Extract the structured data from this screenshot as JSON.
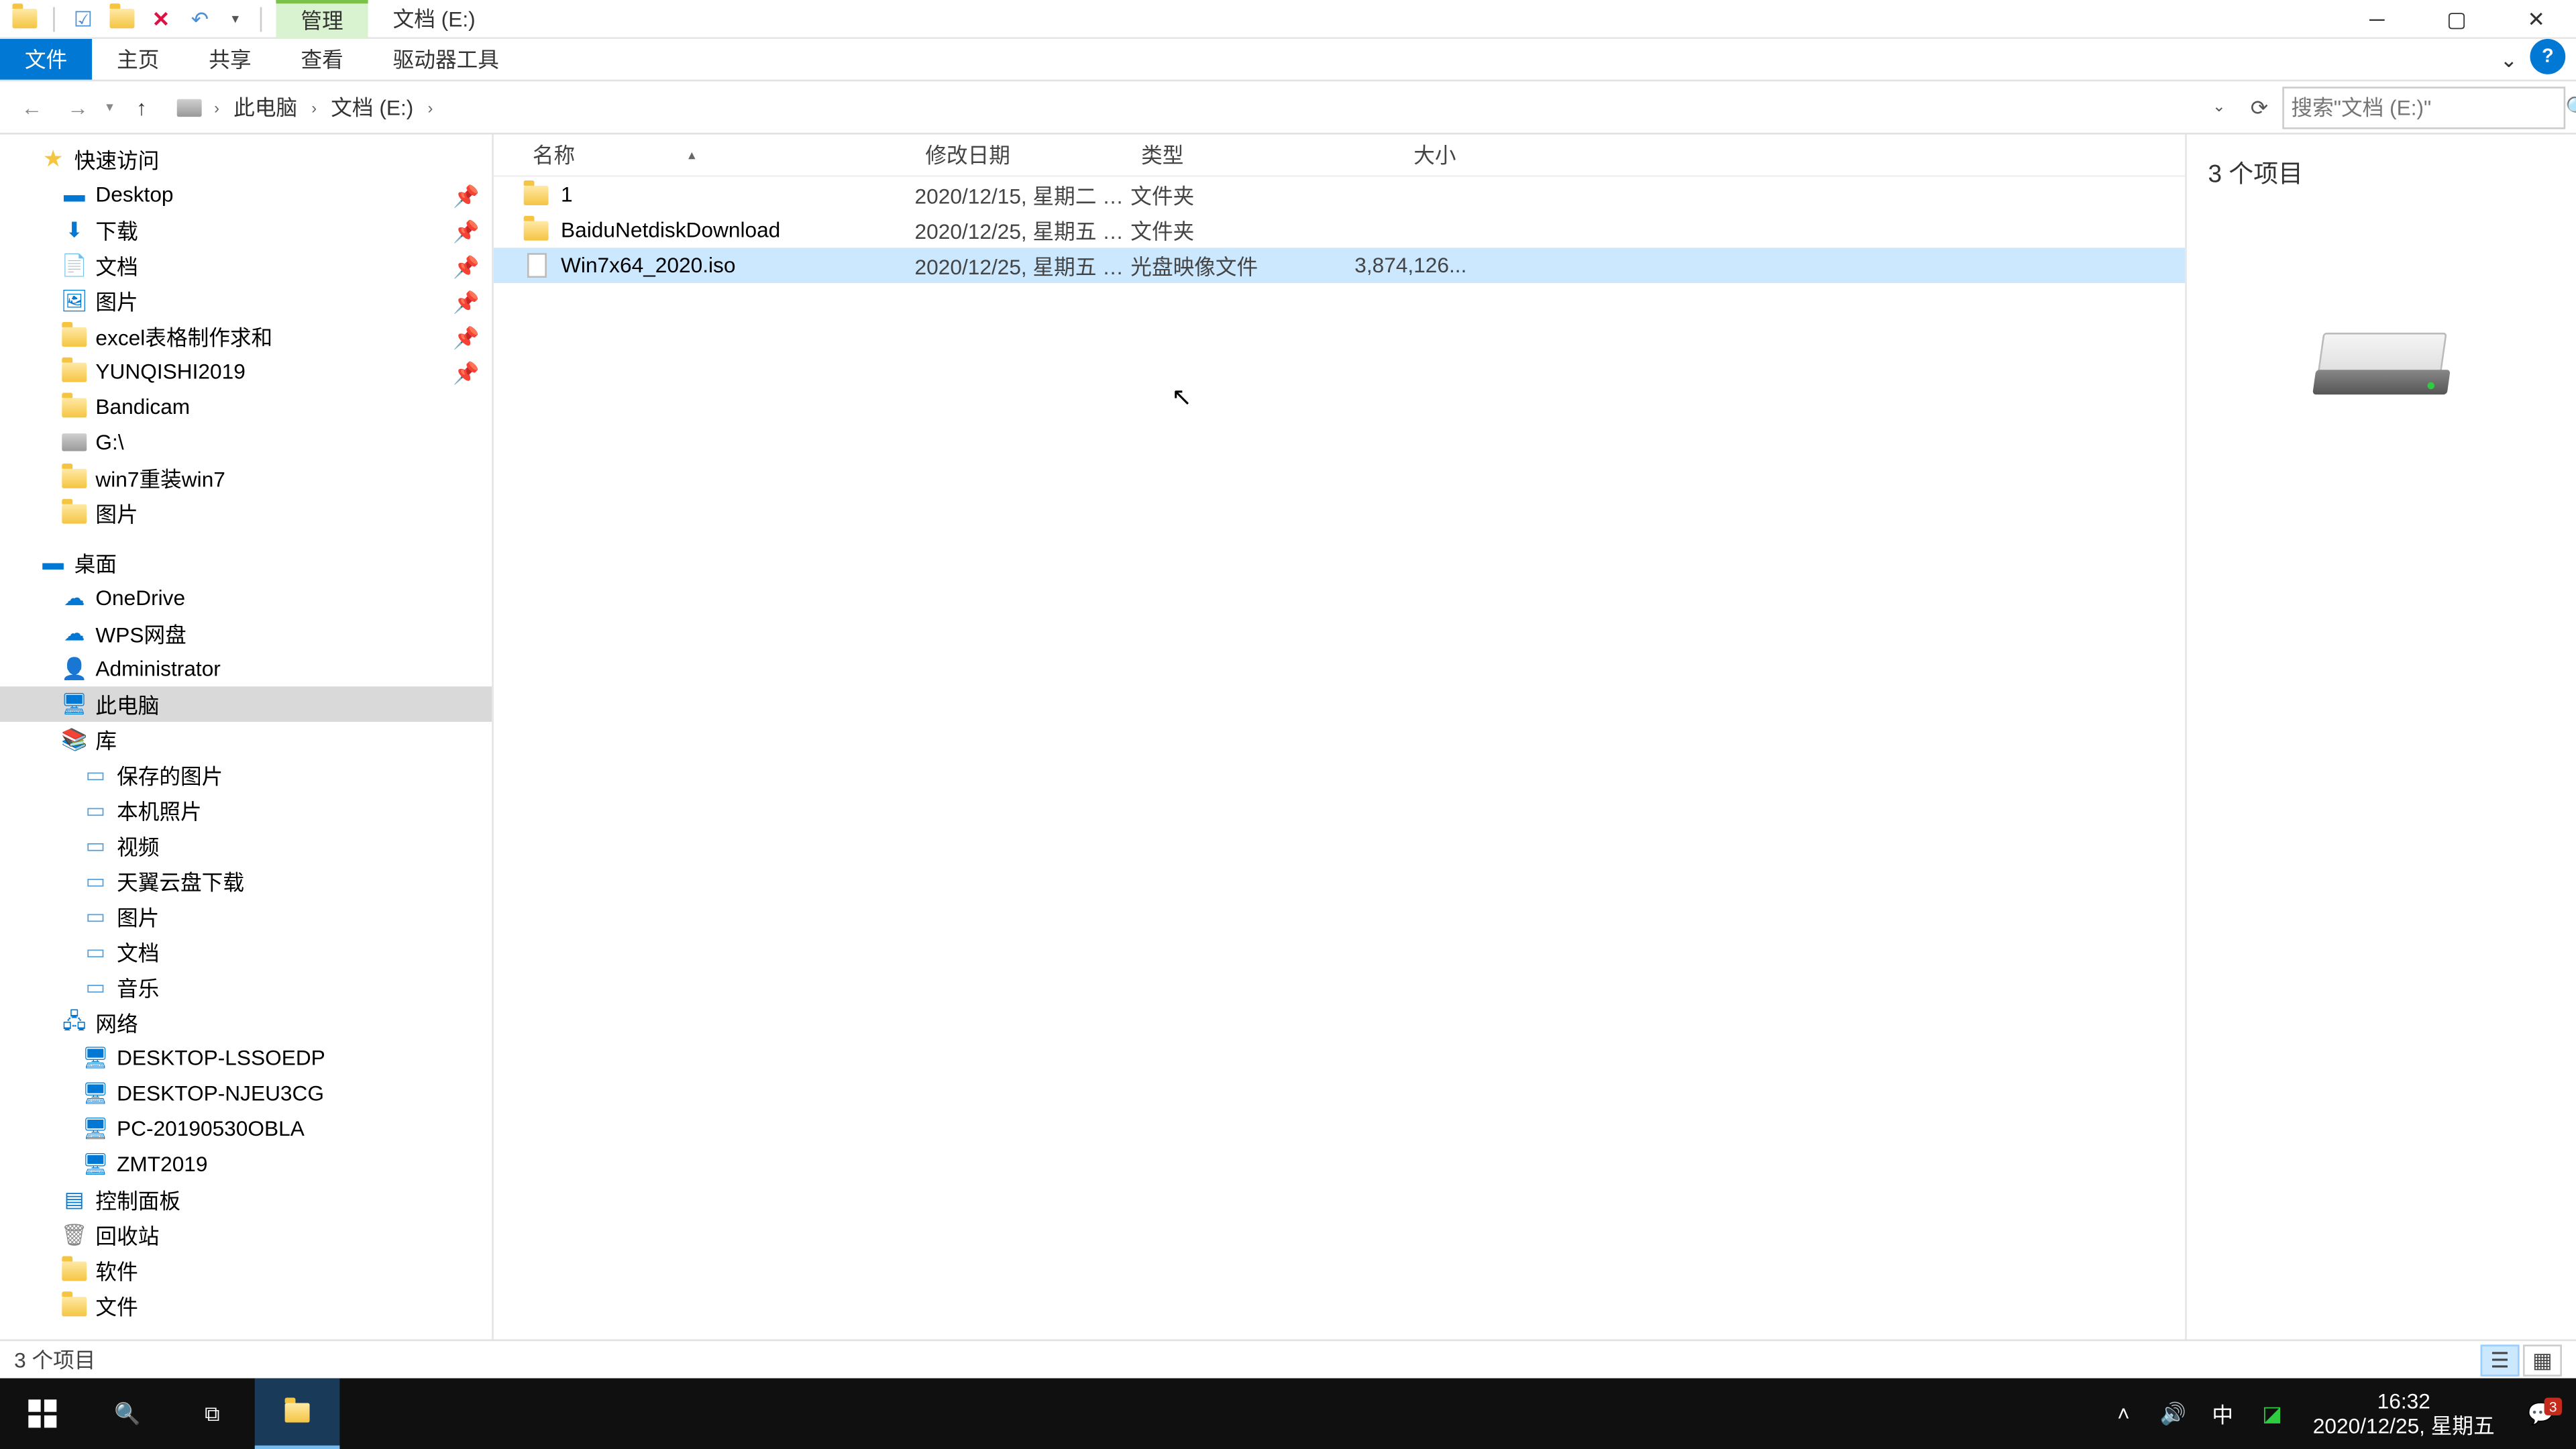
{
  "title": {
    "context_tab": "管理",
    "location_tab": "文档 (E:)"
  },
  "ribbon": {
    "file": "文件",
    "home": "主页",
    "share": "共享",
    "view": "查看",
    "drive_tools": "驱动器工具"
  },
  "breadcrumb": {
    "root": "此电脑",
    "current": "文档 (E:)"
  },
  "search": {
    "placeholder": "搜索\"文档 (E:)\""
  },
  "columns": {
    "name": "名称",
    "date": "修改日期",
    "type": "类型",
    "size": "大小"
  },
  "files": [
    {
      "name": "1",
      "date": "2020/12/15, 星期二 1...",
      "type": "文件夹",
      "size": "",
      "icon": "folder",
      "selected": false
    },
    {
      "name": "BaiduNetdiskDownload",
      "date": "2020/12/25, 星期五 1...",
      "type": "文件夹",
      "size": "",
      "icon": "folder",
      "selected": false
    },
    {
      "name": "Win7x64_2020.iso",
      "date": "2020/12/25, 星期五 1...",
      "type": "光盘映像文件",
      "size": "3,874,126...",
      "icon": "file",
      "selected": true
    }
  ],
  "preview": {
    "count_label": "3 个项目"
  },
  "tree": {
    "quick_access": "快速访问",
    "desktop": "Desktop",
    "downloads": "下载",
    "documents": "文档",
    "pictures": "图片",
    "excel": "excel表格制作求和",
    "yunqishi": "YUNQISHI2019",
    "bandicam": "Bandicam",
    "gdrive": "G:\\",
    "win7": "win7重装win7",
    "pictures2": "图片",
    "desktop_root": "桌面",
    "onedrive": "OneDrive",
    "wps": "WPS网盘",
    "admin": "Administrator",
    "this_pc": "此电脑",
    "library": "库",
    "saved_pics": "保存的图片",
    "camera": "本机照片",
    "video": "视频",
    "tianyi": "天翼云盘下载",
    "pics_lib": "图片",
    "docs_lib": "文档",
    "music": "音乐",
    "network": "网络",
    "pc1": "DESKTOP-LSSOEDP",
    "pc2": "DESKTOP-NJEU3CG",
    "pc3": "PC-20190530OBLA",
    "pc4": "ZMT2019",
    "control_panel": "控制面板",
    "recycle": "回收站",
    "software": "软件",
    "files_folder": "文件"
  },
  "status": {
    "text": "3 个项目"
  },
  "clock": {
    "time": "16:32",
    "date": "2020/12/25, 星期五"
  },
  "tray": {
    "ime": "中",
    "notif_count": "3"
  }
}
